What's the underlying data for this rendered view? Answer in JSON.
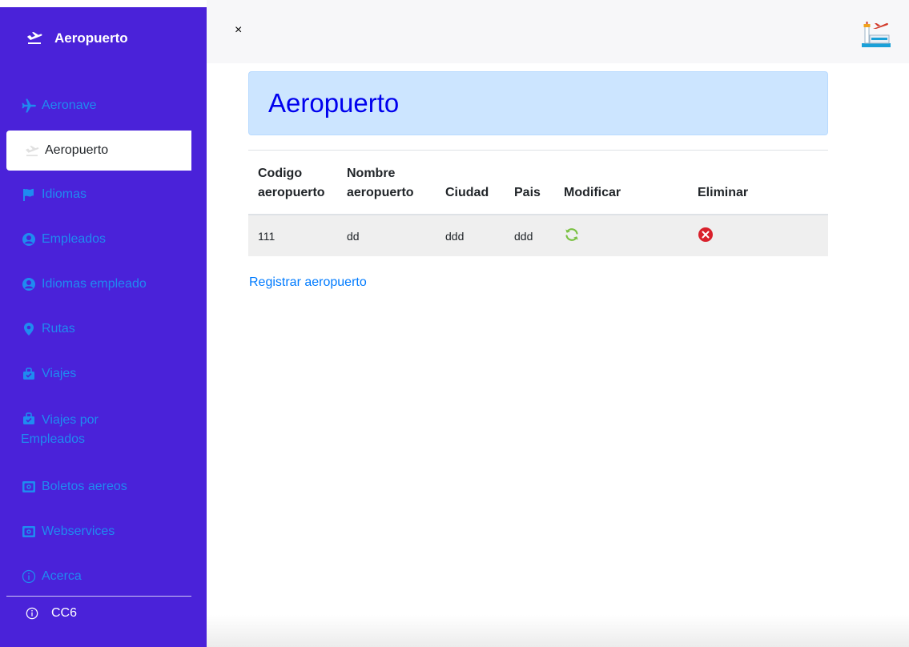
{
  "app": {
    "brand": "Aeropuerto"
  },
  "sidebar": {
    "items": [
      {
        "label": "Aeronave",
        "icon": "plane-icon"
      },
      {
        "label": "Aeropuerto",
        "icon": "plane-departure-icon",
        "active": true
      },
      {
        "label": "Idiomas",
        "icon": "flag-icon"
      },
      {
        "label": "Empleados",
        "icon": "user-circle-icon"
      },
      {
        "label": "Idiomas empleado",
        "icon": "user-circle-icon"
      },
      {
        "label": "Rutas",
        "icon": "map-marker-icon"
      },
      {
        "label": "Viajes",
        "icon": "briefcase-icon"
      },
      {
        "label": "Viajes por Empleados",
        "icon": "briefcase-icon"
      },
      {
        "label": "Boletos aereos",
        "icon": "ticket-icon"
      },
      {
        "label": "Webservices",
        "icon": "ticket-icon"
      },
      {
        "label": "Acerca",
        "icon": "info-icon"
      }
    ],
    "footer": {
      "label": "CC6",
      "icon": "info-icon"
    }
  },
  "topbar": {
    "close_label": "×"
  },
  "page": {
    "title": "Aeropuerto",
    "register_link": "Registrar aeropuerto"
  },
  "table": {
    "columns": [
      "Codigo aeropuerto",
      "Nombre aeropuerto",
      "Ciudad",
      "Pais",
      "Modificar",
      "Eliminar"
    ],
    "rows": [
      {
        "codigo": "111",
        "nombre": "dd",
        "ciudad": "ddd",
        "pais": "ddd"
      }
    ]
  },
  "colors": {
    "sidebar_bg": "#4a22d9",
    "nav_link": "#1f8bf0",
    "header_bg": "#cce5ff",
    "title": "#0000ee",
    "modify": "#7ac142",
    "delete": "#d9202b",
    "link": "#007bff"
  }
}
